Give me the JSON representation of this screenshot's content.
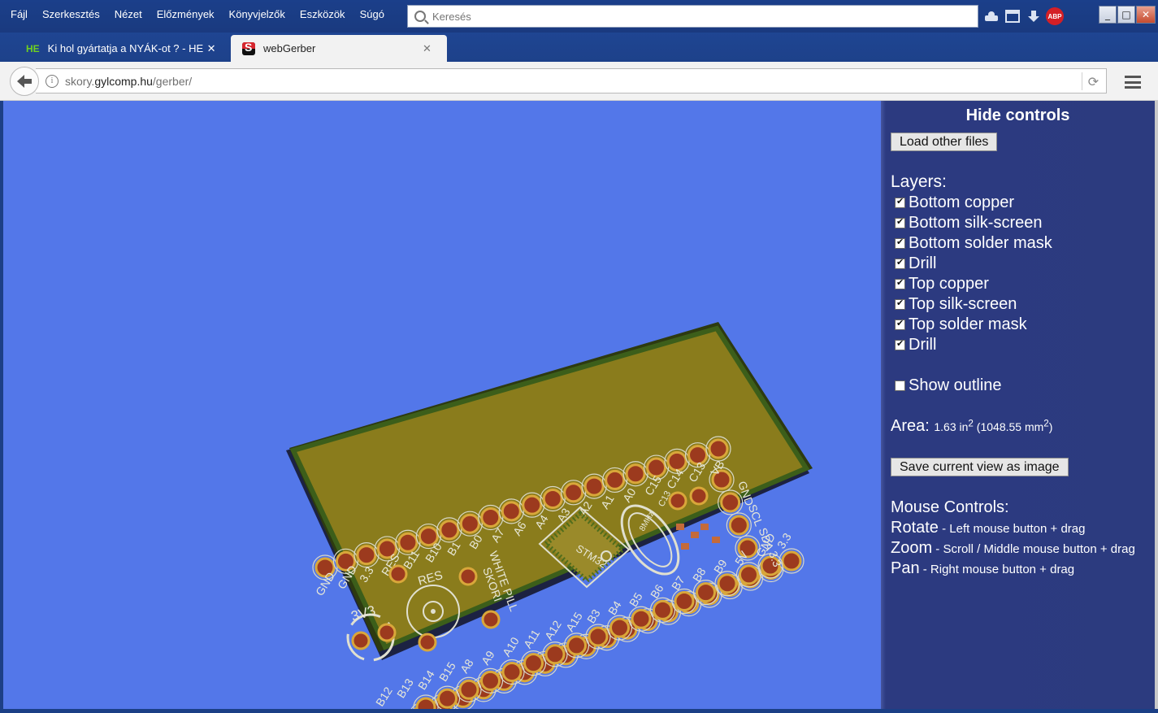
{
  "menu": [
    "Fájl",
    "Szerkesztés",
    "Nézet",
    "Előzmények",
    "Könyvjelzők",
    "Eszközök",
    "Súgó"
  ],
  "search": {
    "placeholder": "Keresés"
  },
  "titlebar_icons": {
    "abp_label": "ABP",
    "minimize": "_",
    "maximize": "□",
    "close": "✕"
  },
  "tabs": [
    {
      "badge": "HE",
      "title": "Ki hol gyártatja a NYÁK-ot ? - HE",
      "close": "✕"
    },
    {
      "title": "webGerber",
      "close": "✕"
    }
  ],
  "address": {
    "prefix": "skory.",
    "host": "gylcomp.hu",
    "path": "/gerber/"
  },
  "controls": {
    "hide_label": "Hide controls",
    "load_files_label": "Load other files",
    "layers_heading": "Layers:",
    "layers": [
      {
        "label": "Bottom copper",
        "checked": true
      },
      {
        "label": "Bottom silk-screen",
        "checked": true
      },
      {
        "label": "Bottom solder mask",
        "checked": true
      },
      {
        "label": "Drill",
        "checked": true
      },
      {
        "label": "Top copper",
        "checked": true
      },
      {
        "label": "Top silk-screen",
        "checked": true
      },
      {
        "label": "Top solder mask",
        "checked": true
      },
      {
        "label": "Drill",
        "checked": true
      }
    ],
    "show_outline_label": "Show outline",
    "show_outline_checked": false,
    "area_label": "Area:",
    "area_in": "1.63 in",
    "area_mm_prefix": "(1048.55 mm",
    "area_mm_suffix": ")",
    "superscript": "2",
    "save_view_label": "Save current view as image",
    "mouse_heading": "Mouse Controls:",
    "mouse_controls": [
      {
        "action": "Rotate",
        "desc": " - Left mouse button + drag"
      },
      {
        "action": "Zoom",
        "desc": " - Scroll / Middle mouse button + drag"
      },
      {
        "action": "Pan",
        "desc": " - Right mouse button + drag"
      }
    ]
  },
  "pcb": {
    "labels_top": [
      "GND",
      "GND",
      "3.3",
      "RES",
      "B11",
      "B10",
      "B1",
      "B0",
      "A7",
      "A6",
      "A4",
      "A3",
      "A2",
      "A1",
      "A0",
      "C15",
      "C14",
      "C13",
      "VB"
    ],
    "labels_bottom": [
      "B12",
      "B13",
      "B14",
      "B15",
      "A8",
      "A9",
      "A10",
      "A11",
      "A12",
      "A15",
      "B3",
      "B4",
      "B5",
      "B6",
      "B7",
      "B8",
      "B9",
      "5V",
      "GND",
      "3.3"
    ],
    "right_labels": [
      "GND",
      "SCL",
      "SDA",
      "3.3"
    ],
    "silk_3v3": "3V3",
    "silk_res": "RES",
    "silk_white": "WHITE PILL",
    "silk_skori": "SKORI",
    "silk_chip": "STM32",
    "silk_osc": "8MHz",
    "silk_c13": "C13"
  }
}
